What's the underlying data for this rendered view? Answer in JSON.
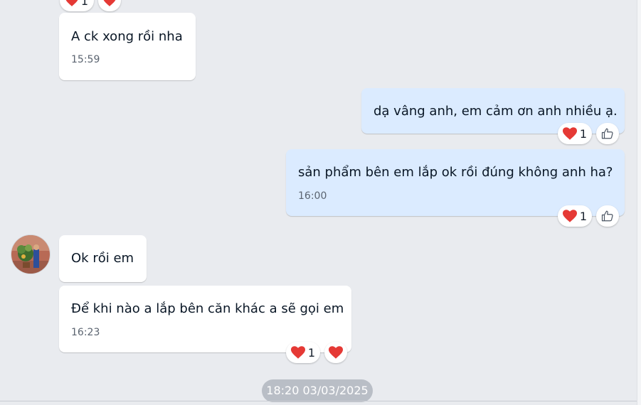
{
  "messages": [
    {
      "text": "A ck xong rồi nha",
      "time": "15:59"
    },
    {
      "text": "dạ vâng anh, em cảm ơn anh nhiều ạ."
    },
    {
      "text": "sản phẩm bên em lắp ok rồi đúng không anh ha?",
      "time": "16:00"
    },
    {
      "text": "Ok rồi em"
    },
    {
      "text": "Để khi nào a lắp bên căn khác a sẽ gọi em",
      "time": "16:23"
    }
  ],
  "reactions": {
    "top_heart_count": "1",
    "msg2_heart_count": "1",
    "msg3_heart_count": "1",
    "msg5_heart_count": "1"
  },
  "date_separator": "18:20 03/03/2025",
  "colors": {
    "background": "#e9ebef",
    "incoming_bubble": "#ffffff",
    "outgoing_bubble": "#dbebff",
    "heart": "#e53935",
    "date_chip": "#b9bec6"
  },
  "icons": [
    "heart-icon",
    "thumbs-up-icon",
    "avatar"
  ]
}
